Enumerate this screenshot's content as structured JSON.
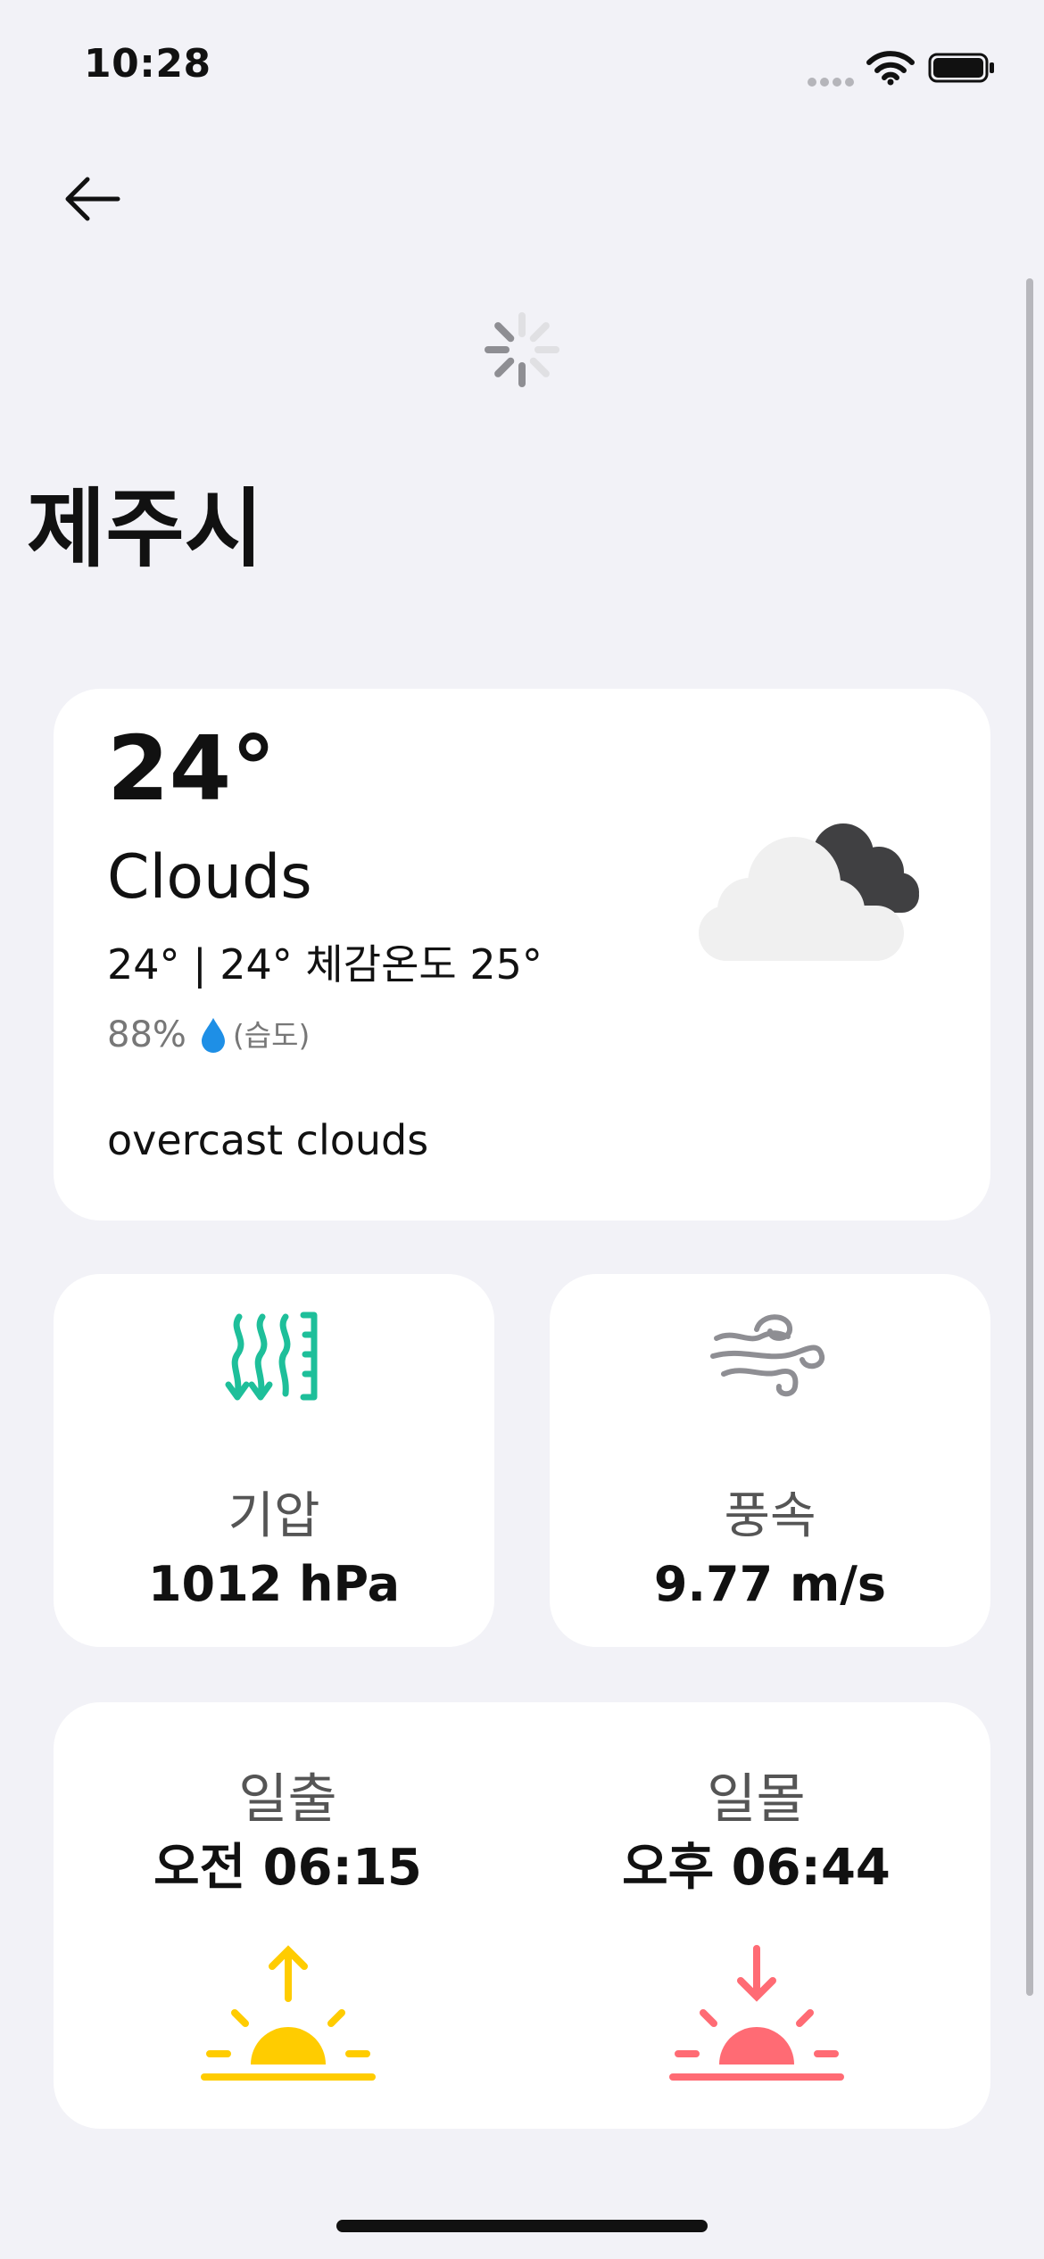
{
  "status_bar": {
    "time": "10:28"
  },
  "header": {
    "back_icon": "arrow-left-icon",
    "loading_icon": "spinner-icon"
  },
  "city": "제주시",
  "current": {
    "temp": "24°",
    "condition": "Clouds",
    "detail": "24° | 24° 체감온도 25°",
    "humidity_value": "88%",
    "humidity_label": "(습도)",
    "description": "overcast clouds",
    "weather_icon": "cloud-night-icon"
  },
  "pressure": {
    "label": "기압",
    "value": "1012 hPa",
    "icon": "pressure-arrows-icon",
    "color": "#1ebf9a"
  },
  "wind": {
    "label": "풍속",
    "value": "9.77 m/s",
    "icon": "wind-icon",
    "color": "#8e8e93"
  },
  "sun": {
    "sunrise_label": "일출",
    "sunrise_time": "오전 06:15",
    "sunrise_color": "#ffcc00",
    "sunset_label": "일몰",
    "sunset_time": "오후 06:44",
    "sunset_color": "#ff6b74"
  }
}
